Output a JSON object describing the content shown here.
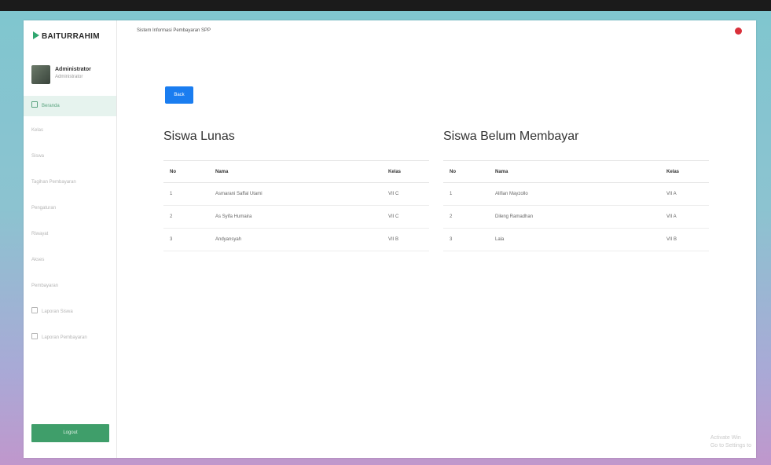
{
  "brand": {
    "name": "BAITURRAHIM"
  },
  "user": {
    "name": "Administrator",
    "role": "Administrator"
  },
  "header": {
    "breadcrumb": "Sistem Informasi Pembayaran SPP"
  },
  "sidebar": {
    "items": [
      {
        "label": "Beranda"
      },
      {
        "label": "Kelas"
      },
      {
        "label": "Siswa"
      },
      {
        "label": "Tagihan Pembayaran"
      },
      {
        "label": "Pengaturan"
      },
      {
        "label": "Riwayat"
      },
      {
        "label": "Akses"
      },
      {
        "label": "Pembayaran"
      },
      {
        "label": "Laporan Siswa"
      },
      {
        "label": "Laporan Pembayaran"
      }
    ],
    "logout_label": "Logout"
  },
  "main": {
    "back_label": "Back",
    "lunas": {
      "title": "Siswa Lunas",
      "columns": [
        "No",
        "Nama",
        "Kelas"
      ],
      "rows": [
        [
          "1",
          "Asmarani Saffal Utami",
          "VII C"
        ],
        [
          "2",
          "As Syifa Humaira",
          "VII C"
        ],
        [
          "3",
          "Andyansyah",
          "VII B"
        ]
      ]
    },
    "belum": {
      "title": "Siswa Belum Membayar",
      "columns": [
        "No",
        "Nama",
        "Kelas"
      ],
      "rows": [
        [
          "1",
          "Alifian Mayzollo",
          "VII A"
        ],
        [
          "2",
          "Dileng Ramadhan",
          "VII A"
        ],
        [
          "3",
          "Lala",
          "VII B"
        ]
      ]
    }
  },
  "watermark": {
    "line1": "Activate Win",
    "line2": "Go to Settings to"
  },
  "colors": {
    "accent": "#1a7df0",
    "brand_green": "#3f9e6a",
    "active_bg": "#e6f3ee",
    "notif": "#d9303a"
  }
}
